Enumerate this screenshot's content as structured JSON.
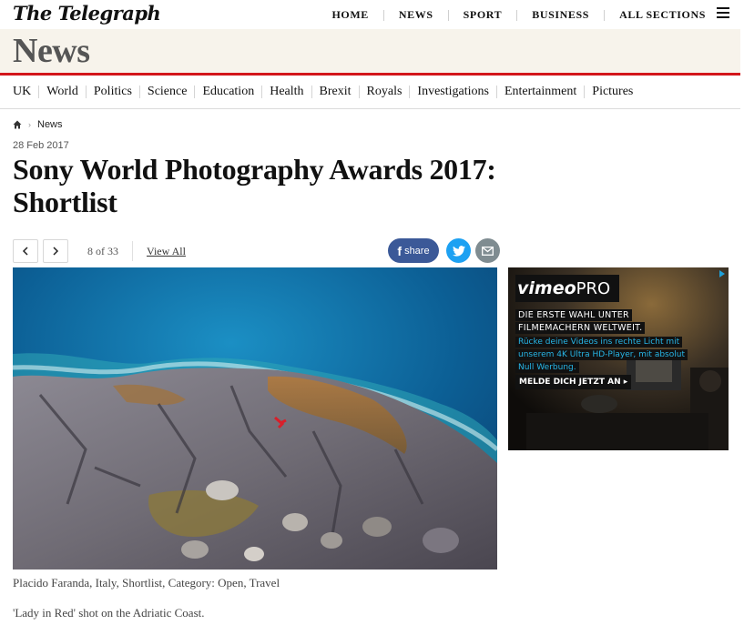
{
  "header": {
    "logo": "The Telegraph",
    "nav": [
      "HOME",
      "NEWS",
      "SPORT",
      "BUSINESS",
      "ALL SECTIONS"
    ]
  },
  "section": {
    "title": "News"
  },
  "subnav": [
    "UK",
    "World",
    "Politics",
    "Science",
    "Education",
    "Health",
    "Brexit",
    "Royals",
    "Investigations",
    "Entertainment",
    "Pictures"
  ],
  "breadcrumb": {
    "current": "News"
  },
  "article": {
    "date": "28 Feb 2017",
    "headline_line1": "Sony World Photography Awards 2017:",
    "headline_line2": "Shortlist"
  },
  "gallery": {
    "counter": "8 of 33",
    "view_all": "View All",
    "share_label": "share",
    "caption": "Placido Faranda, Italy, Shortlist, Category: Open, Travel",
    "description": "'Lady in Red' shot on the Adriatic Coast."
  },
  "ad": {
    "brand": "vimeo",
    "brand_suffix": "PRO",
    "headline_1": "DIE ERSTE WAHL UNTER",
    "headline_2": "FILMEMACHERN WELTWEIT.",
    "body_1": "Rücke deine Videos ins rechte Licht mit",
    "body_2": "unserem 4K Ultra HD-Player, mit absolut",
    "body_3": "Null Werbung.",
    "cta": "MELDE DICH JETZT AN"
  },
  "colors": {
    "accent_red": "#d3151a",
    "section_bg": "#f7f3eb",
    "facebook": "#3b5998",
    "twitter": "#1da1f2",
    "mail": "#7f8c91",
    "vimeo_blue": "#27b5e6"
  },
  "icons": [
    "menu-icon",
    "home-icon",
    "chevron-left-icon",
    "chevron-right-icon",
    "facebook-icon",
    "twitter-icon",
    "mail-icon",
    "adchoices-icon"
  ]
}
